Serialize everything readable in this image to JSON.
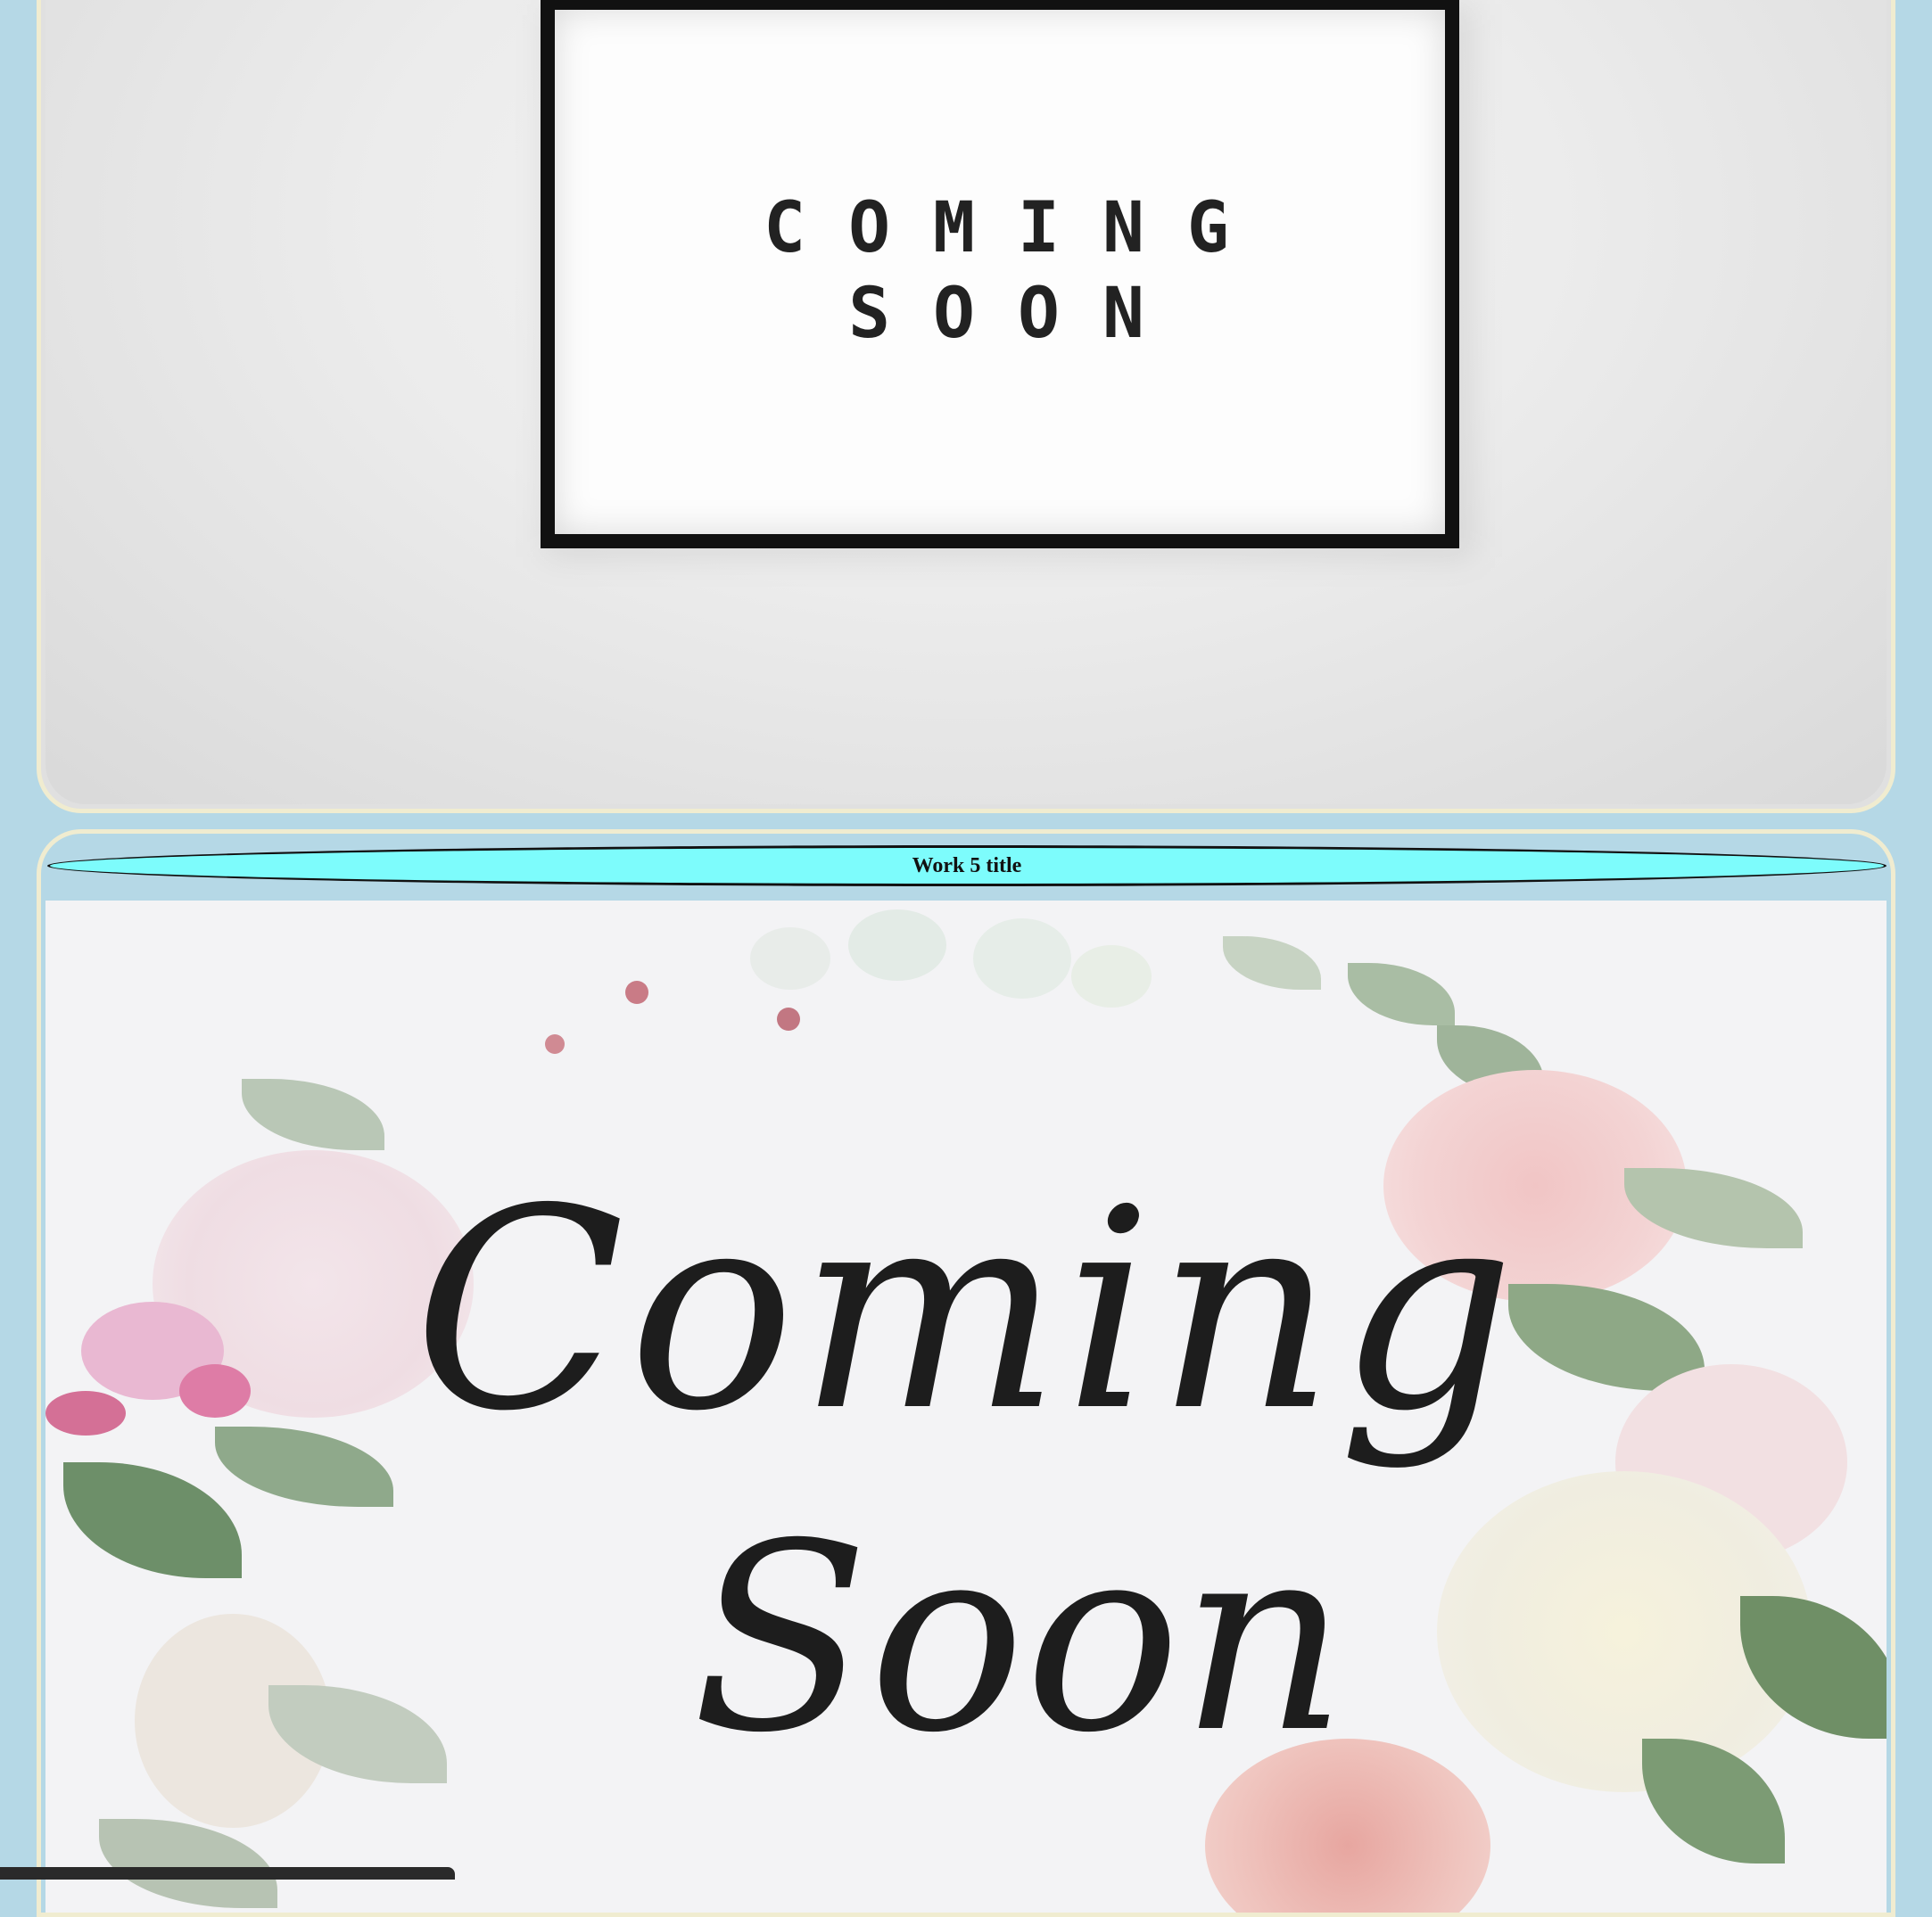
{
  "work4": {
    "frame_line1": "COMING",
    "frame_line2": "SOON"
  },
  "work5": {
    "title": "Work 5 title",
    "script_line1": "Coming",
    "script_line2": "Soon"
  },
  "colors": {
    "page_background": "#b5d8e6",
    "card_border": "#f0ecd0",
    "title_bar": "#7dfcfc"
  }
}
